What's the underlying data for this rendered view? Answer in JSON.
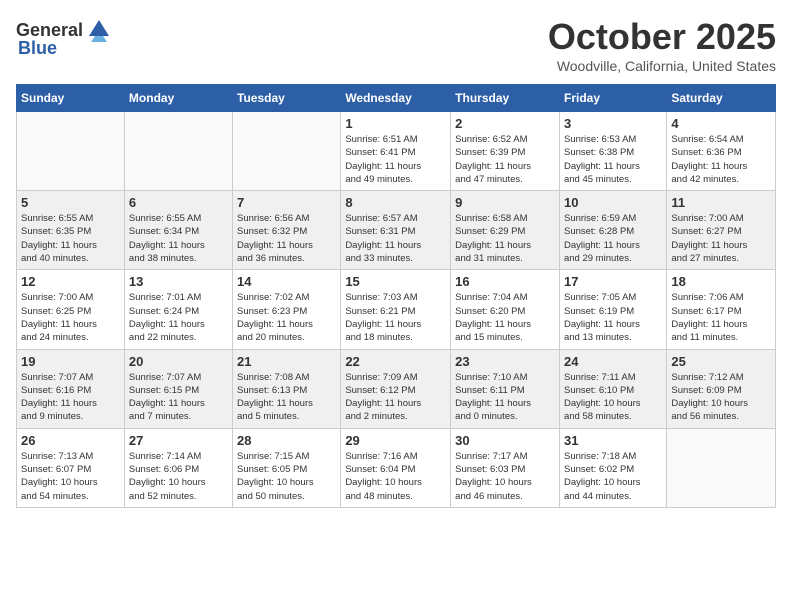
{
  "header": {
    "logo_general": "General",
    "logo_blue": "Blue",
    "month": "October 2025",
    "location": "Woodville, California, United States"
  },
  "days_of_week": [
    "Sunday",
    "Monday",
    "Tuesday",
    "Wednesday",
    "Thursday",
    "Friday",
    "Saturday"
  ],
  "weeks": [
    [
      {
        "day": "",
        "info": ""
      },
      {
        "day": "",
        "info": ""
      },
      {
        "day": "",
        "info": ""
      },
      {
        "day": "1",
        "info": "Sunrise: 6:51 AM\nSunset: 6:41 PM\nDaylight: 11 hours\nand 49 minutes."
      },
      {
        "day": "2",
        "info": "Sunrise: 6:52 AM\nSunset: 6:39 PM\nDaylight: 11 hours\nand 47 minutes."
      },
      {
        "day": "3",
        "info": "Sunrise: 6:53 AM\nSunset: 6:38 PM\nDaylight: 11 hours\nand 45 minutes."
      },
      {
        "day": "4",
        "info": "Sunrise: 6:54 AM\nSunset: 6:36 PM\nDaylight: 11 hours\nand 42 minutes."
      }
    ],
    [
      {
        "day": "5",
        "info": "Sunrise: 6:55 AM\nSunset: 6:35 PM\nDaylight: 11 hours\nand 40 minutes."
      },
      {
        "day": "6",
        "info": "Sunrise: 6:55 AM\nSunset: 6:34 PM\nDaylight: 11 hours\nand 38 minutes."
      },
      {
        "day": "7",
        "info": "Sunrise: 6:56 AM\nSunset: 6:32 PM\nDaylight: 11 hours\nand 36 minutes."
      },
      {
        "day": "8",
        "info": "Sunrise: 6:57 AM\nSunset: 6:31 PM\nDaylight: 11 hours\nand 33 minutes."
      },
      {
        "day": "9",
        "info": "Sunrise: 6:58 AM\nSunset: 6:29 PM\nDaylight: 11 hours\nand 31 minutes."
      },
      {
        "day": "10",
        "info": "Sunrise: 6:59 AM\nSunset: 6:28 PM\nDaylight: 11 hours\nand 29 minutes."
      },
      {
        "day": "11",
        "info": "Sunrise: 7:00 AM\nSunset: 6:27 PM\nDaylight: 11 hours\nand 27 minutes."
      }
    ],
    [
      {
        "day": "12",
        "info": "Sunrise: 7:00 AM\nSunset: 6:25 PM\nDaylight: 11 hours\nand 24 minutes."
      },
      {
        "day": "13",
        "info": "Sunrise: 7:01 AM\nSunset: 6:24 PM\nDaylight: 11 hours\nand 22 minutes."
      },
      {
        "day": "14",
        "info": "Sunrise: 7:02 AM\nSunset: 6:23 PM\nDaylight: 11 hours\nand 20 minutes."
      },
      {
        "day": "15",
        "info": "Sunrise: 7:03 AM\nSunset: 6:21 PM\nDaylight: 11 hours\nand 18 minutes."
      },
      {
        "day": "16",
        "info": "Sunrise: 7:04 AM\nSunset: 6:20 PM\nDaylight: 11 hours\nand 15 minutes."
      },
      {
        "day": "17",
        "info": "Sunrise: 7:05 AM\nSunset: 6:19 PM\nDaylight: 11 hours\nand 13 minutes."
      },
      {
        "day": "18",
        "info": "Sunrise: 7:06 AM\nSunset: 6:17 PM\nDaylight: 11 hours\nand 11 minutes."
      }
    ],
    [
      {
        "day": "19",
        "info": "Sunrise: 7:07 AM\nSunset: 6:16 PM\nDaylight: 11 hours\nand 9 minutes."
      },
      {
        "day": "20",
        "info": "Sunrise: 7:07 AM\nSunset: 6:15 PM\nDaylight: 11 hours\nand 7 minutes."
      },
      {
        "day": "21",
        "info": "Sunrise: 7:08 AM\nSunset: 6:13 PM\nDaylight: 11 hours\nand 5 minutes."
      },
      {
        "day": "22",
        "info": "Sunrise: 7:09 AM\nSunset: 6:12 PM\nDaylight: 11 hours\nand 2 minutes."
      },
      {
        "day": "23",
        "info": "Sunrise: 7:10 AM\nSunset: 6:11 PM\nDaylight: 11 hours\nand 0 minutes."
      },
      {
        "day": "24",
        "info": "Sunrise: 7:11 AM\nSunset: 6:10 PM\nDaylight: 10 hours\nand 58 minutes."
      },
      {
        "day": "25",
        "info": "Sunrise: 7:12 AM\nSunset: 6:09 PM\nDaylight: 10 hours\nand 56 minutes."
      }
    ],
    [
      {
        "day": "26",
        "info": "Sunrise: 7:13 AM\nSunset: 6:07 PM\nDaylight: 10 hours\nand 54 minutes."
      },
      {
        "day": "27",
        "info": "Sunrise: 7:14 AM\nSunset: 6:06 PM\nDaylight: 10 hours\nand 52 minutes."
      },
      {
        "day": "28",
        "info": "Sunrise: 7:15 AM\nSunset: 6:05 PM\nDaylight: 10 hours\nand 50 minutes."
      },
      {
        "day": "29",
        "info": "Sunrise: 7:16 AM\nSunset: 6:04 PM\nDaylight: 10 hours\nand 48 minutes."
      },
      {
        "day": "30",
        "info": "Sunrise: 7:17 AM\nSunset: 6:03 PM\nDaylight: 10 hours\nand 46 minutes."
      },
      {
        "day": "31",
        "info": "Sunrise: 7:18 AM\nSunset: 6:02 PM\nDaylight: 10 hours\nand 44 minutes."
      },
      {
        "day": "",
        "info": ""
      }
    ]
  ]
}
